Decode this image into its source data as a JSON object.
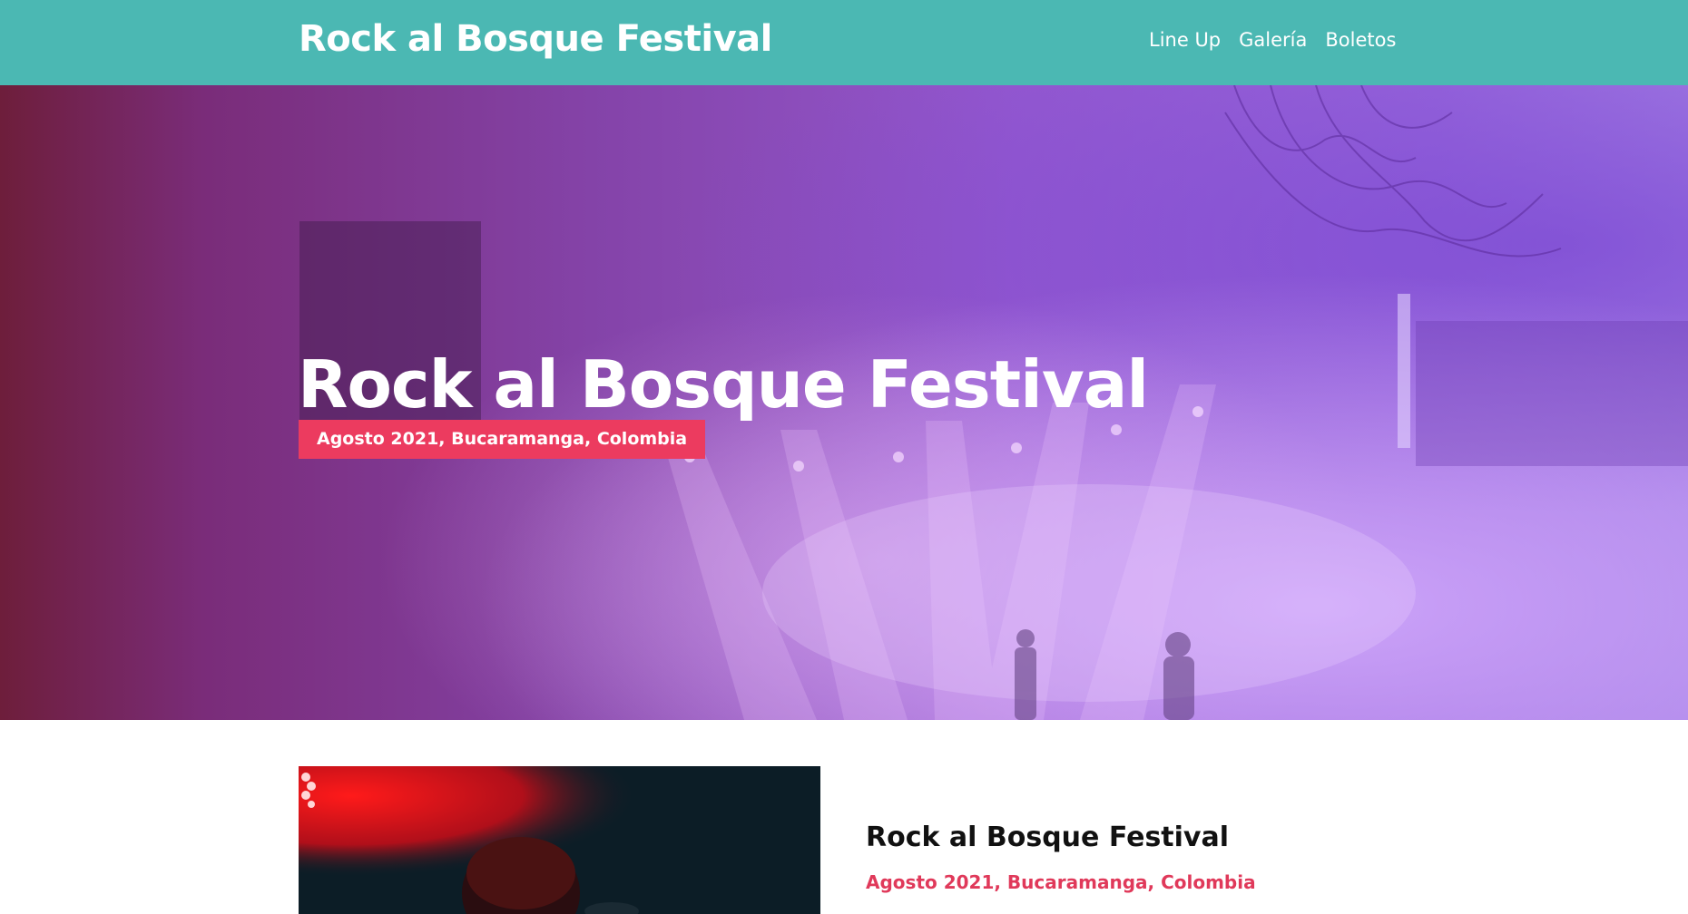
{
  "header": {
    "brand": "Rock al Bosque Festival",
    "nav": [
      "Line Up",
      "Galería",
      "Boletos"
    ]
  },
  "hero": {
    "title": "Rock al Bosque Festival",
    "subtitle": "Agosto 2021, Bucaramanga, Colombia"
  },
  "content": {
    "title": "Rock al Bosque Festival",
    "subtitle": "Agosto 2021, Bucaramanga, Colombia"
  },
  "colors": {
    "header_bg": "#4bb8b3",
    "badge_bg": "#ec3b5f",
    "accent_text": "#e0395a",
    "hero_purple": "#9458cf"
  }
}
